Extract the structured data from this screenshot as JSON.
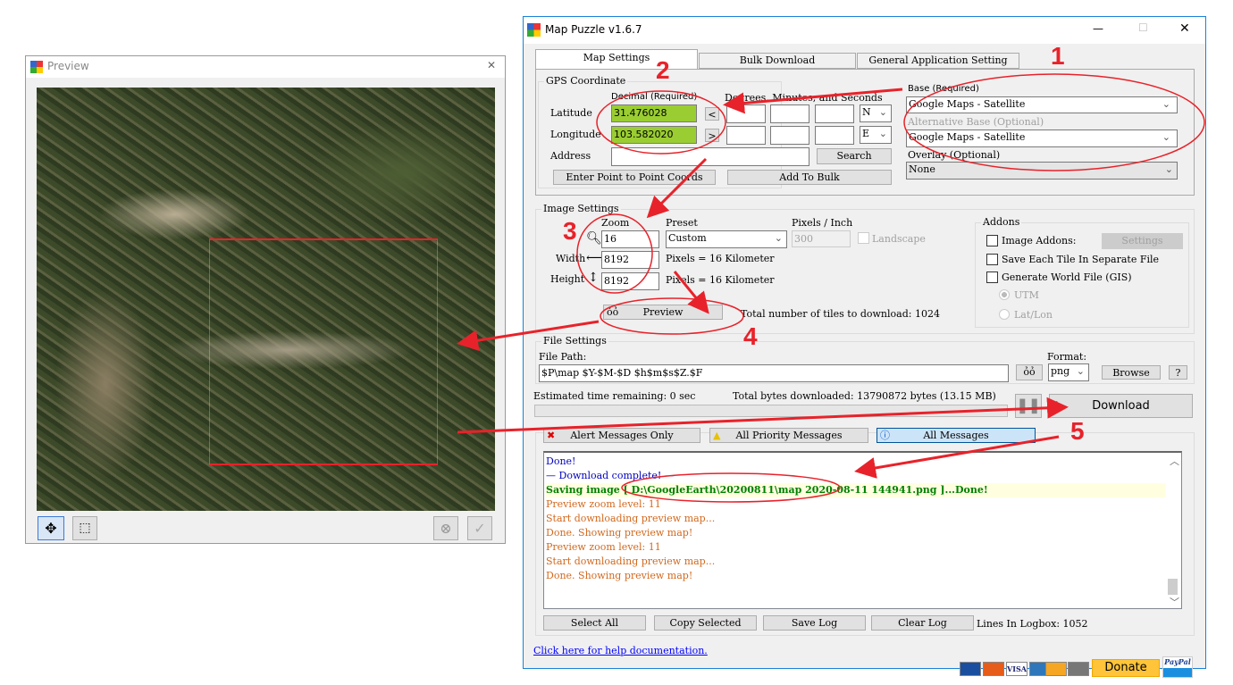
{
  "preview": {
    "title": "Preview",
    "close": "✕"
  },
  "main": {
    "title": "Map Puzzle v1.6.7",
    "minimize": "—",
    "maximize": "☐",
    "close": "✕",
    "tabs": [
      "Map Settings",
      "Bulk Download",
      "General  Application Setting"
    ],
    "gps": {
      "group": "GPS Coordinate",
      "decimal_label": "Decimal (Required)",
      "dms_label": "Degrees, Minutes, and Seconds",
      "latitude_label": "Latitude",
      "longitude_label": "Longitude",
      "address_label": "Address",
      "latitude": "31.476028",
      "longitude": "103.582020",
      "address": "",
      "lat_btn": "<",
      "lon_btn": ">",
      "lat_dir": "N",
      "lon_dir": "E",
      "search": "Search",
      "p2p": "Enter Point to Point Coords",
      "add_bulk": "Add To Bulk"
    },
    "layers": {
      "base_label": "Base (Required)",
      "base": "Google Maps - Satellite",
      "alt_label": "Alternative Base (Optional)",
      "alt": "Google Maps - Satellite",
      "overlay_label": "Overlay (Optional)",
      "overlay": "None"
    },
    "image": {
      "group": "Image Settings",
      "zoom_label": "Zoom",
      "zoom": "16",
      "preset_label": "Preset",
      "preset": "Custom",
      "ppi_label": "Pixels / Inch",
      "ppi": "300",
      "landscape": "Landscape",
      "width_label": "Width",
      "width": "8192",
      "height_label": "Height",
      "height": "8192",
      "width_info": "Pixels = 16 Kilometer",
      "height_info": "Pixels = 16 Kilometer",
      "preview": "Preview",
      "tiles": "Total number of tiles to download: 1024"
    },
    "addons": {
      "group": "Addons",
      "image_addons": "Image Addons:",
      "settings": "Settings",
      "separate": "Save Each Tile In Separate File",
      "world": "Generate World File (GIS)",
      "utm": "UTM",
      "latlon": "Lat/Lon"
    },
    "file": {
      "group": "File Settings",
      "path_label": "File Path:",
      "path": "$P\\map $Y-$M-$D $h$m$s$Z.$F",
      "format_label": "Format:",
      "format": "png",
      "browse": "Browse",
      "help": "?"
    },
    "status": {
      "eta": "Estimated time remaining: 0 sec",
      "bytes": "Total bytes downloaded: 13790872 bytes (13.15 MB)",
      "download": "Download",
      "progress": 0
    },
    "filters": [
      "Alert Messages Only",
      "All Priority Messages",
      "All Messages"
    ],
    "log": [
      {
        "t": "Done!",
        "c": "blue"
      },
      {
        "t": "— Download complete! —",
        "c": "blue"
      },
      {
        "t": "Saving image [ D:\\GoogleEarth\\20200811\\map 2020-08-11 144941.png ]...Done!",
        "c": "grn"
      },
      {
        "t": "Preview zoom level: 11",
        "c": "org"
      },
      {
        "t": "Start downloading preview map...",
        "c": "org"
      },
      {
        "t": "Done. Showing preview map!",
        "c": "org"
      },
      {
        "t": "Preview zoom level: 11",
        "c": "org"
      },
      {
        "t": "Start downloading preview map...",
        "c": "org"
      },
      {
        "t": "Done. Showing preview map!",
        "c": "org"
      }
    ],
    "log_buttons": [
      "Select All",
      "Copy Selected",
      "Save Log",
      "Clear Log"
    ],
    "lines": "Lines In Logbox: 1052",
    "help_link": "Click here for help documentation.",
    "donate": "Donate",
    "paypal": "PayPal"
  },
  "annotations": [
    "1",
    "2",
    "3",
    "4",
    "5"
  ],
  "colors": {
    "accent_green": "#9acd32",
    "annotation_red": "#e8222a"
  }
}
